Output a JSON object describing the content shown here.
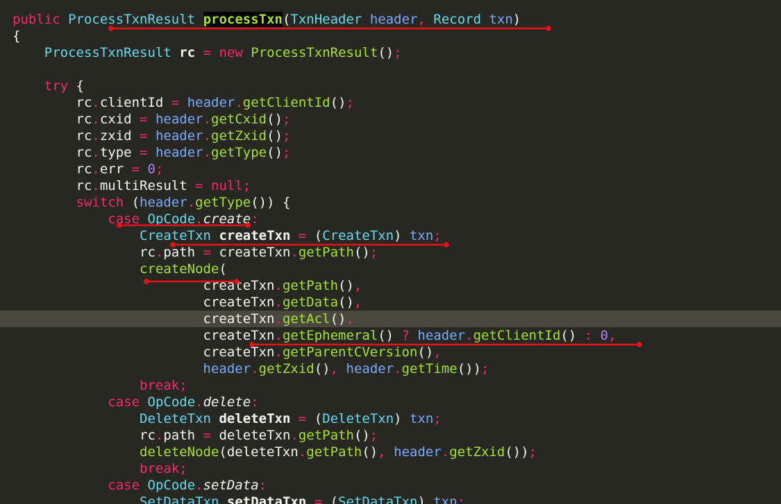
{
  "editor": {
    "current_line": 18,
    "lines": [
      [
        {
          "t": "public",
          "c": "kw"
        },
        {
          "t": " "
        },
        {
          "t": "ProcessTxnResult",
          "c": "ty"
        },
        {
          "t": " "
        },
        {
          "t": "processTxn",
          "c": "fn bd hl"
        },
        {
          "t": "("
        },
        {
          "t": "TxnHeader",
          "c": "ty"
        },
        {
          "t": " "
        },
        {
          "t": "header",
          "c": "pm"
        },
        {
          "t": ",",
          "c": "pu"
        },
        {
          "t": " "
        },
        {
          "t": "Record",
          "c": "ty"
        },
        {
          "t": " "
        },
        {
          "t": "txn",
          "c": "pm"
        },
        {
          "t": ")"
        }
      ],
      [
        {
          "t": "{"
        }
      ],
      [
        {
          "t": "    "
        },
        {
          "t": "ProcessTxnResult",
          "c": "ty"
        },
        {
          "t": " "
        },
        {
          "t": "rc",
          "c": "bd"
        },
        {
          "t": " "
        },
        {
          "t": "=",
          "c": "pu"
        },
        {
          "t": " "
        },
        {
          "t": "new",
          "c": "kw"
        },
        {
          "t": " "
        },
        {
          "t": "ProcessTxnResult",
          "c": "fn"
        },
        {
          "t": "()"
        },
        {
          "t": ";",
          "c": "pu"
        }
      ],
      [],
      [
        {
          "t": "    "
        },
        {
          "t": "try",
          "c": "kw"
        },
        {
          "t": " {"
        }
      ],
      [
        {
          "t": "        rc"
        },
        {
          "t": ".",
          "c": "pu"
        },
        {
          "t": "clientId "
        },
        {
          "t": "=",
          "c": "pu"
        },
        {
          "t": " "
        },
        {
          "t": "header",
          "c": "pm"
        },
        {
          "t": ".",
          "c": "pu"
        },
        {
          "t": "getClientId",
          "c": "fn"
        },
        {
          "t": "()"
        },
        {
          "t": ";",
          "c": "pu"
        }
      ],
      [
        {
          "t": "        rc"
        },
        {
          "t": ".",
          "c": "pu"
        },
        {
          "t": "cxid "
        },
        {
          "t": "=",
          "c": "pu"
        },
        {
          "t": " "
        },
        {
          "t": "header",
          "c": "pm"
        },
        {
          "t": ".",
          "c": "pu"
        },
        {
          "t": "getCxid",
          "c": "fn"
        },
        {
          "t": "()"
        },
        {
          "t": ";",
          "c": "pu"
        }
      ],
      [
        {
          "t": "        rc"
        },
        {
          "t": ".",
          "c": "pu"
        },
        {
          "t": "zxid "
        },
        {
          "t": "=",
          "c": "pu"
        },
        {
          "t": " "
        },
        {
          "t": "header",
          "c": "pm"
        },
        {
          "t": ".",
          "c": "pu"
        },
        {
          "t": "getZxid",
          "c": "fn"
        },
        {
          "t": "()"
        },
        {
          "t": ";",
          "c": "pu"
        }
      ],
      [
        {
          "t": "        rc"
        },
        {
          "t": ".",
          "c": "pu"
        },
        {
          "t": "type "
        },
        {
          "t": "=",
          "c": "pu"
        },
        {
          "t": " "
        },
        {
          "t": "header",
          "c": "pm"
        },
        {
          "t": ".",
          "c": "pu"
        },
        {
          "t": "getType",
          "c": "fn"
        },
        {
          "t": "()"
        },
        {
          "t": ";",
          "c": "pu"
        }
      ],
      [
        {
          "t": "        rc"
        },
        {
          "t": ".",
          "c": "pu"
        },
        {
          "t": "err "
        },
        {
          "t": "=",
          "c": "pu"
        },
        {
          "t": " "
        },
        {
          "t": "0",
          "c": "nm"
        },
        {
          "t": ";",
          "c": "pu"
        }
      ],
      [
        {
          "t": "        rc"
        },
        {
          "t": ".",
          "c": "pu"
        },
        {
          "t": "multiResult "
        },
        {
          "t": "=",
          "c": "pu"
        },
        {
          "t": " "
        },
        {
          "t": "null",
          "c": "kw"
        },
        {
          "t": ";",
          "c": "pu"
        }
      ],
      [
        {
          "t": "        "
        },
        {
          "t": "switch",
          "c": "kw"
        },
        {
          "t": " ("
        },
        {
          "t": "header",
          "c": "pm"
        },
        {
          "t": ".",
          "c": "pu"
        },
        {
          "t": "getType",
          "c": "fn"
        },
        {
          "t": "()) {"
        }
      ],
      [
        {
          "t": "            "
        },
        {
          "t": "case",
          "c": "kw"
        },
        {
          "t": " "
        },
        {
          "t": "OpCode",
          "c": "ty"
        },
        {
          "t": ".",
          "c": "pu"
        },
        {
          "t": "create",
          "c": "it"
        },
        {
          "t": ":",
          "c": "pu"
        }
      ],
      [
        {
          "t": "                "
        },
        {
          "t": "CreateTxn",
          "c": "ty"
        },
        {
          "t": " "
        },
        {
          "t": "createTxn",
          "c": "bd"
        },
        {
          "t": " "
        },
        {
          "t": "=",
          "c": "pu"
        },
        {
          "t": " ("
        },
        {
          "t": "CreateTxn",
          "c": "ty"
        },
        {
          "t": ") "
        },
        {
          "t": "txn",
          "c": "pm"
        },
        {
          "t": ";",
          "c": "pu"
        }
      ],
      [
        {
          "t": "                rc"
        },
        {
          "t": ".",
          "c": "pu"
        },
        {
          "t": "path "
        },
        {
          "t": "=",
          "c": "pu"
        },
        {
          "t": " createTxn"
        },
        {
          "t": ".",
          "c": "pu"
        },
        {
          "t": "getPath",
          "c": "fn"
        },
        {
          "t": "()"
        },
        {
          "t": ";",
          "c": "pu"
        }
      ],
      [
        {
          "t": "                "
        },
        {
          "t": "createNode",
          "c": "fn"
        },
        {
          "t": "("
        }
      ],
      [
        {
          "t": "                        createTxn"
        },
        {
          "t": ".",
          "c": "pu"
        },
        {
          "t": "getPath",
          "c": "fn"
        },
        {
          "t": "()"
        },
        {
          "t": ",",
          "c": "pu"
        }
      ],
      [
        {
          "t": "                        createTxn"
        },
        {
          "t": ".",
          "c": "pu"
        },
        {
          "t": "getData",
          "c": "fn"
        },
        {
          "t": "()"
        },
        {
          "t": ",",
          "c": "pu"
        }
      ],
      [
        {
          "t": "                        createTxn"
        },
        {
          "t": ".",
          "c": "pu"
        },
        {
          "t": "getAcl",
          "c": "fn"
        },
        {
          "t": "()"
        },
        {
          "t": ",",
          "c": "pu"
        }
      ],
      [
        {
          "t": "                        createTxn"
        },
        {
          "t": ".",
          "c": "pu"
        },
        {
          "t": "getEphemeral",
          "c": "fn"
        },
        {
          "t": "() "
        },
        {
          "t": "?",
          "c": "pu"
        },
        {
          "t": " "
        },
        {
          "t": "header",
          "c": "pm"
        },
        {
          "t": ".",
          "c": "pu"
        },
        {
          "t": "getClientId",
          "c": "fn"
        },
        {
          "t": "() "
        },
        {
          "t": ":",
          "c": "pu"
        },
        {
          "t": " "
        },
        {
          "t": "0",
          "c": "nm"
        },
        {
          "t": ",",
          "c": "pu"
        }
      ],
      [
        {
          "t": "                        createTxn"
        },
        {
          "t": ".",
          "c": "pu"
        },
        {
          "t": "getParentCVersion",
          "c": "fn"
        },
        {
          "t": "()"
        },
        {
          "t": ",",
          "c": "pu"
        }
      ],
      [
        {
          "t": "                        "
        },
        {
          "t": "header",
          "c": "pm"
        },
        {
          "t": ".",
          "c": "pu"
        },
        {
          "t": "getZxid",
          "c": "fn"
        },
        {
          "t": "()"
        },
        {
          "t": ",",
          "c": "pu"
        },
        {
          "t": " "
        },
        {
          "t": "header",
          "c": "pm"
        },
        {
          "t": ".",
          "c": "pu"
        },
        {
          "t": "getTime",
          "c": "fn"
        },
        {
          "t": "())"
        },
        {
          "t": ";",
          "c": "pu"
        }
      ],
      [
        {
          "t": "                "
        },
        {
          "t": "break",
          "c": "kw"
        },
        {
          "t": ";",
          "c": "pu"
        }
      ],
      [
        {
          "t": "            "
        },
        {
          "t": "case",
          "c": "kw"
        },
        {
          "t": " "
        },
        {
          "t": "OpCode",
          "c": "ty"
        },
        {
          "t": ".",
          "c": "pu"
        },
        {
          "t": "delete",
          "c": "it"
        },
        {
          "t": ":",
          "c": "pu"
        }
      ],
      [
        {
          "t": "                "
        },
        {
          "t": "DeleteTxn",
          "c": "ty"
        },
        {
          "t": " "
        },
        {
          "t": "deleteTxn",
          "c": "bd"
        },
        {
          "t": " "
        },
        {
          "t": "=",
          "c": "pu"
        },
        {
          "t": " ("
        },
        {
          "t": "DeleteTxn",
          "c": "ty"
        },
        {
          "t": ") "
        },
        {
          "t": "txn",
          "c": "pm"
        },
        {
          "t": ";",
          "c": "pu"
        }
      ],
      [
        {
          "t": "                rc"
        },
        {
          "t": ".",
          "c": "pu"
        },
        {
          "t": "path "
        },
        {
          "t": "=",
          "c": "pu"
        },
        {
          "t": " deleteTxn"
        },
        {
          "t": ".",
          "c": "pu"
        },
        {
          "t": "getPath",
          "c": "fn"
        },
        {
          "t": "()"
        },
        {
          "t": ";",
          "c": "pu"
        }
      ],
      [
        {
          "t": "                "
        },
        {
          "t": "deleteNode",
          "c": "fn"
        },
        {
          "t": "(deleteTxn"
        },
        {
          "t": ".",
          "c": "pu"
        },
        {
          "t": "getPath",
          "c": "fn"
        },
        {
          "t": "()"
        },
        {
          "t": ",",
          "c": "pu"
        },
        {
          "t": " "
        },
        {
          "t": "header",
          "c": "pm"
        },
        {
          "t": ".",
          "c": "pu"
        },
        {
          "t": "getZxid",
          "c": "fn"
        },
        {
          "t": "())"
        },
        {
          "t": ";",
          "c": "pu"
        }
      ],
      [
        {
          "t": "                "
        },
        {
          "t": "break",
          "c": "kw"
        },
        {
          "t": ";",
          "c": "pu"
        }
      ],
      [
        {
          "t": "            "
        },
        {
          "t": "case",
          "c": "kw"
        },
        {
          "t": " "
        },
        {
          "t": "OpCode",
          "c": "ty"
        },
        {
          "t": ".",
          "c": "pu"
        },
        {
          "t": "setData",
          "c": "it"
        },
        {
          "t": ":",
          "c": "pu"
        }
      ],
      [
        {
          "t": "                "
        },
        {
          "t": "SetDataTxn",
          "c": "ty"
        },
        {
          "t": " "
        },
        {
          "t": "setDataTxn",
          "c": "bd"
        },
        {
          "t": " "
        },
        {
          "t": "=",
          "c": "pu"
        },
        {
          "t": " ("
        },
        {
          "t": "SetDataTxn",
          "c": "ty"
        },
        {
          "t": ") "
        },
        {
          "t": "txn",
          "c": "pm"
        },
        {
          "t": ";",
          "c": "pu"
        }
      ]
    ]
  },
  "annotations": {
    "color": "#e8101a"
  }
}
